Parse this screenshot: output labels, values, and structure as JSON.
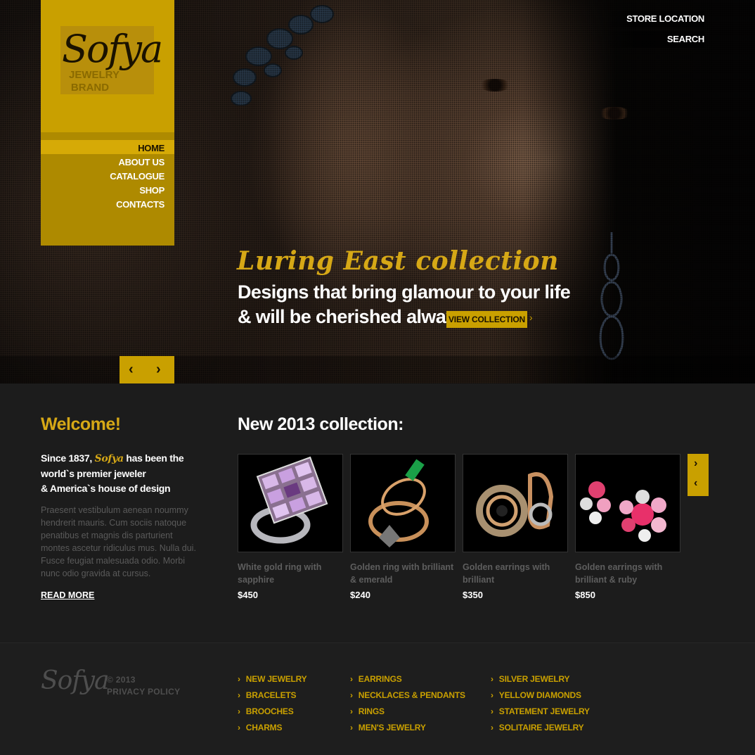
{
  "brand": {
    "logo": "Sofya",
    "sub1": "JEWELRY",
    "sub2": "BRAND"
  },
  "nav": {
    "items": [
      "HOME",
      "ABOUT US",
      "CATALOGUE",
      "SHOP",
      "CONTACTS"
    ],
    "active": "HOME"
  },
  "top_links": [
    "STORE LOCATION",
    "SEARCH"
  ],
  "hero": {
    "script": "Luring East collection",
    "line1": "Designs that bring glamour to your life",
    "line2": "& will be cherished always",
    "button": "VIEW COLLECTION",
    "prev_icon": "chevron-left-icon",
    "next_icon": "chevron-right-icon"
  },
  "welcome": {
    "title": "Welcome!",
    "lead_pre": "Since 1837,",
    "lead_brand": "Sofya",
    "lead_post1": "has been the",
    "lead_line2": "world`s premier jeweler",
    "lead_line3": "& America`s house of design",
    "body": "Praesent vestibulum aenean noummy hendrerit mauris. Cum sociis natoque penatibus et magnis dis parturient montes ascetur ridiculus mus. Nulla dui. Fusce feugiat malesuada odio. Morbi nunc odio gravida at cursus.",
    "read_more": "READ MORE"
  },
  "collection": {
    "title": "New 2013 collection:",
    "products": [
      {
        "name": "White gold ring with sapphire",
        "price": "$450"
      },
      {
        "name": "Golden ring with brilliant & emerald",
        "price": "$240"
      },
      {
        "name": "Golden earrings with brilliant",
        "price": "$350"
      },
      {
        "name": "Golden earrings with brilliant & ruby",
        "price": "$850"
      }
    ]
  },
  "footer": {
    "logo": "Sofya",
    "copyright": "© 2013",
    "privacy": "PRIVACY POLICY",
    "col1": [
      "NEW JEWELRY",
      "BRACELETS",
      "BROOCHES",
      "CHARMS"
    ],
    "col2": [
      "EARRINGS",
      "NECKLACES & PENDANTS",
      "RINGS",
      "MEN'S JEWELRY"
    ],
    "col3": [
      "SILVER JEWELRY",
      "YELLOW DIAMONDS",
      "STATEMENT JEWELRY",
      "SOLITAIRE JEWELRY"
    ]
  },
  "colors": {
    "accent": "#c9a000",
    "background": "#1c1c1c"
  }
}
